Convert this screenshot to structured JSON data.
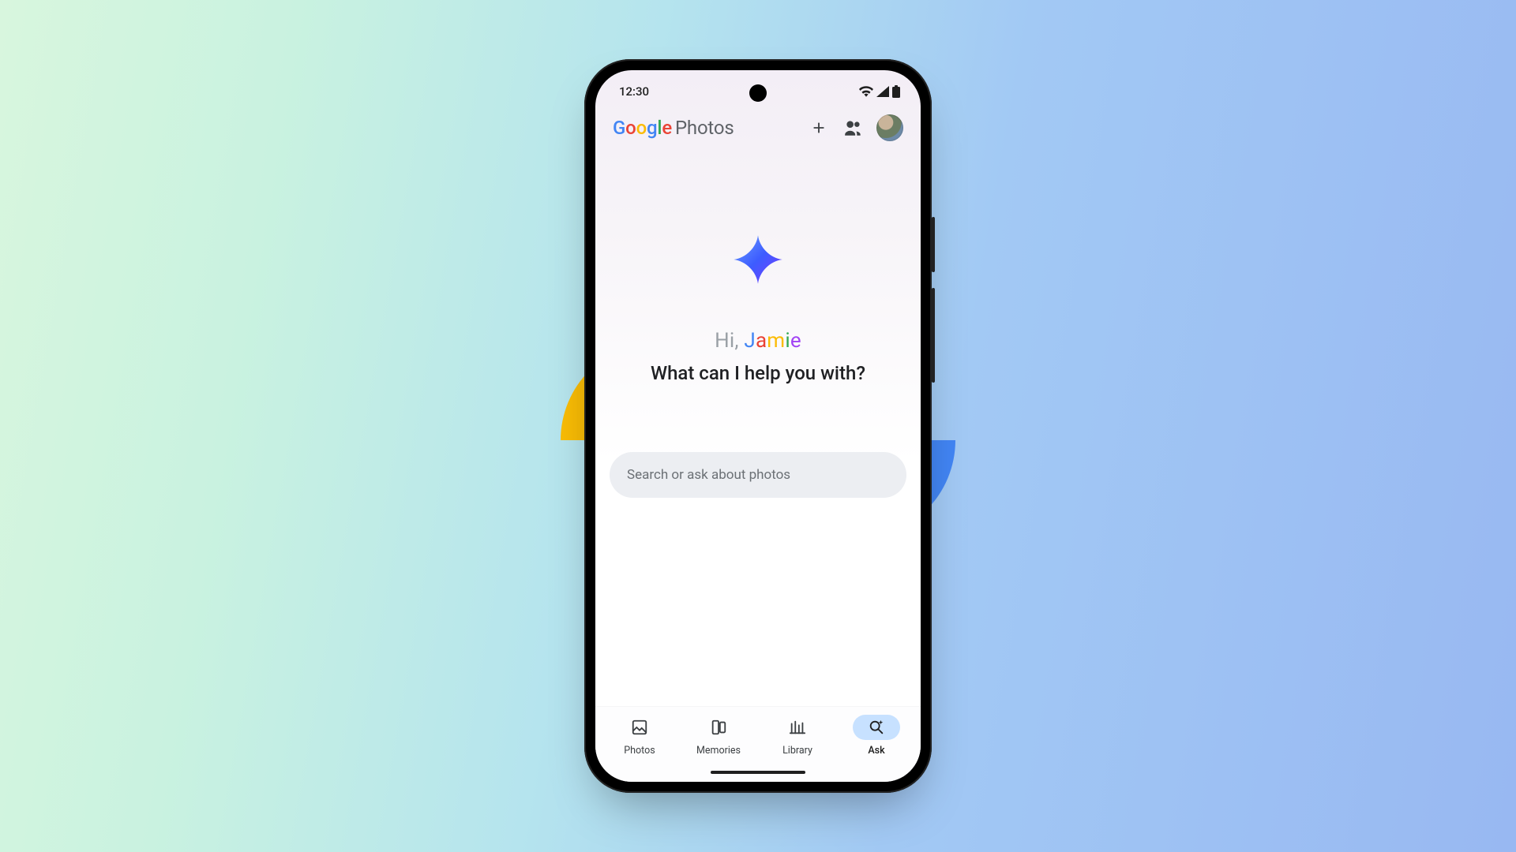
{
  "statusbar": {
    "time": "12:30"
  },
  "appbar": {
    "brand_google": "Google",
    "brand_photos": "Photos"
  },
  "hero": {
    "greeting_prefix": "Hi, ",
    "greeting_name": "Jamie",
    "prompt": "What can I help you with?"
  },
  "search": {
    "placeholder": "Search or ask about photos"
  },
  "nav": {
    "photos": "Photos",
    "memories": "Memories",
    "library": "Library",
    "ask": "Ask"
  },
  "colors": {
    "google_blue": "#4285f4",
    "google_red": "#ea4335",
    "google_yellow": "#fbbc05",
    "google_green": "#34a853"
  }
}
